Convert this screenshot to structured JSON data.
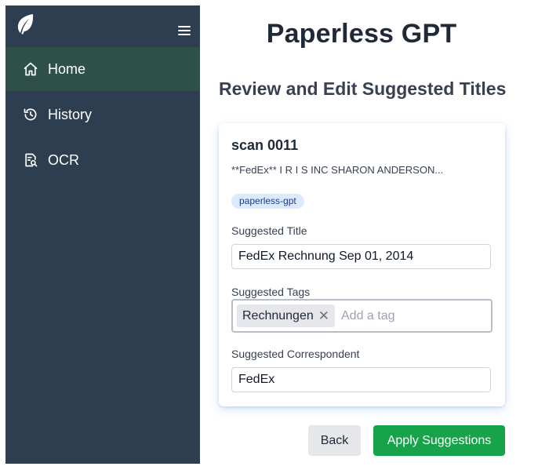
{
  "sidebar": {
    "logo_icon": "leaf-icon",
    "menu_icon": "hamburger-icon",
    "items": [
      {
        "label": "Home",
        "icon": "home-icon",
        "active": true
      },
      {
        "label": "History",
        "icon": "history-icon",
        "active": false
      },
      {
        "label": "OCR",
        "icon": "document-search-icon",
        "active": false
      }
    ]
  },
  "header": {
    "title": "Paperless GPT",
    "subtitle": "Review and Edit Suggested Titles"
  },
  "card": {
    "doc_title": "scan 0011",
    "snippet": "**FedEx** I R I S INC SHARON ANDERSON...",
    "badge": "paperless-gpt",
    "suggested_title_label": "Suggested Title",
    "suggested_title_value": "FedEx Rechnung Sep 01, 2014",
    "suggested_tags_label": "Suggested Tags",
    "tags": [
      "Rechnungen"
    ],
    "tag_placeholder": "Add a tag",
    "suggested_correspondent_label": "Suggested Correspondent",
    "suggested_correspondent_value": "FedEx"
  },
  "actions": {
    "back_label": "Back",
    "apply_label": "Apply Suggestions"
  },
  "colors": {
    "sidebar_bg": "#2d3e50",
    "sidebar_active": "#2e5049",
    "apply_button": "#16a34a",
    "badge_bg": "#dbeafe"
  }
}
